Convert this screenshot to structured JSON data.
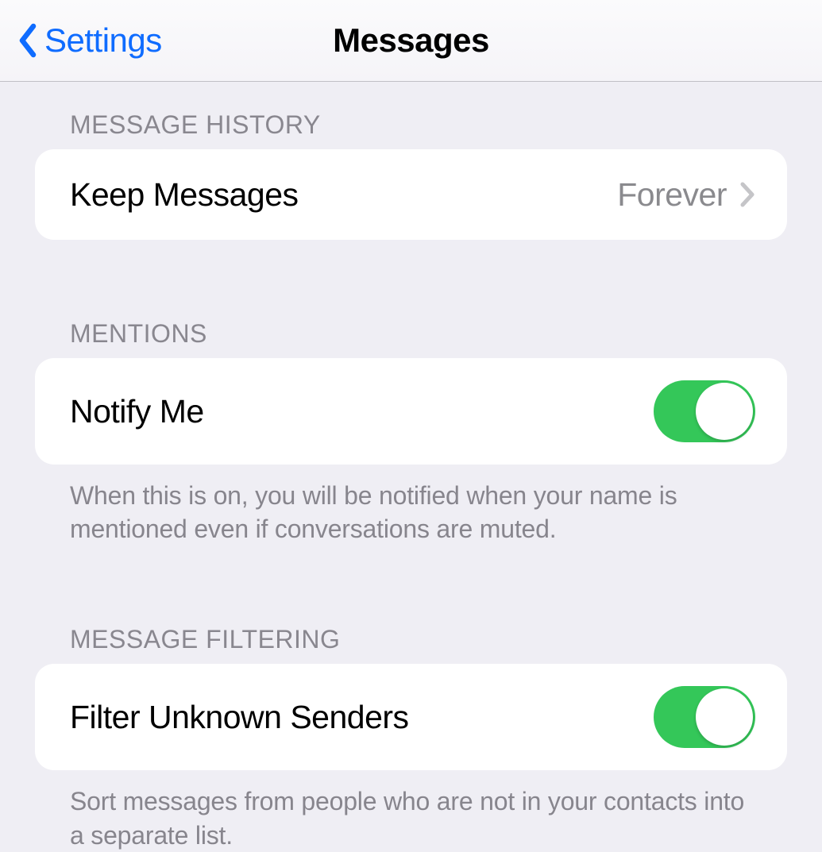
{
  "nav": {
    "back_label": "Settings",
    "title": "Messages"
  },
  "sections": {
    "history": {
      "header": "MESSAGE HISTORY",
      "keep_label": "Keep Messages",
      "keep_value": "Forever"
    },
    "mentions": {
      "header": "MENTIONS",
      "notify_label": "Notify Me",
      "notify_on": true,
      "footer": "When this is on, you will be notified when your name is mentioned even if conversations are muted."
    },
    "filtering": {
      "header": "MESSAGE FILTERING",
      "filter_label": "Filter Unknown Senders",
      "filter_on": true,
      "footer": "Sort messages from people who are not in your contacts into a separate list."
    }
  }
}
